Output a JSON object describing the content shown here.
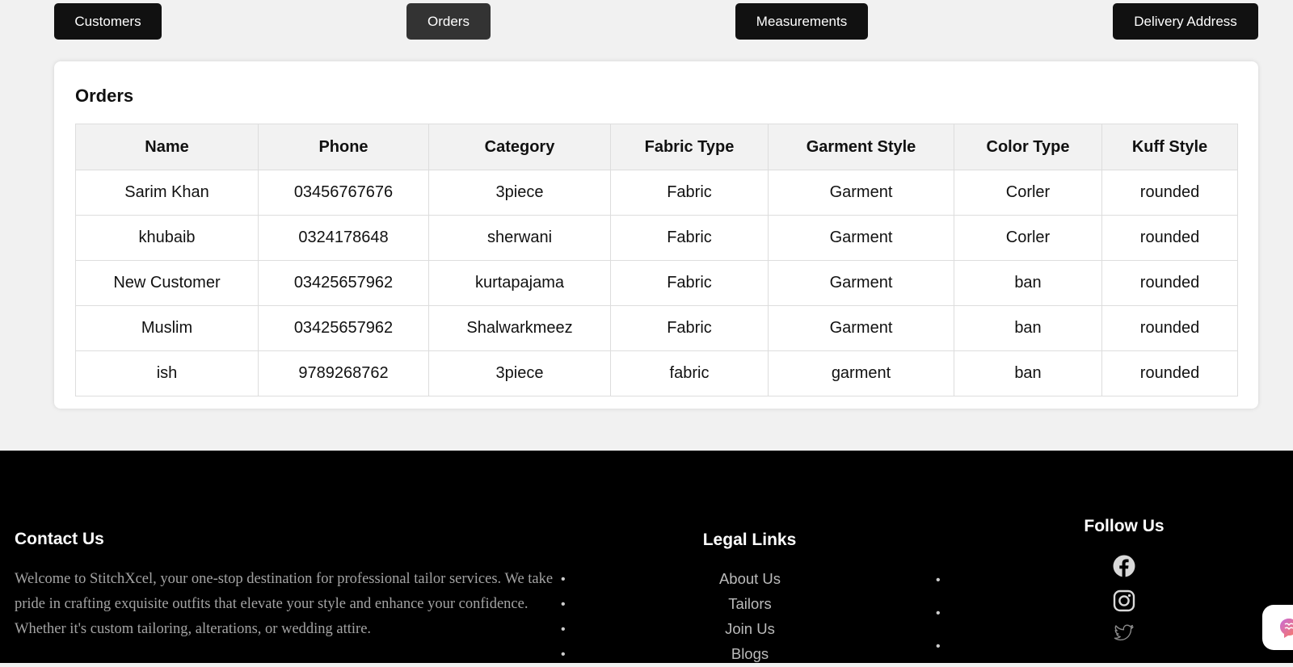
{
  "tabs": [
    {
      "label": "Customers",
      "active": false
    },
    {
      "label": "Orders",
      "active": true
    },
    {
      "label": "Measurements",
      "active": false
    },
    {
      "label": "Delivery Address",
      "active": false
    }
  ],
  "orders": {
    "title": "Orders",
    "columns": [
      "Name",
      "Phone",
      "Category",
      "Fabric Type",
      "Garment Style",
      "Color Type",
      "Kuff Style"
    ],
    "rows": [
      [
        "Sarim Khan",
        "03456767676",
        "3piece",
        "Fabric",
        "Garment",
        "Corler",
        "rounded"
      ],
      [
        "khubaib",
        "0324178648",
        "sherwani",
        "Fabric",
        "Garment",
        "Corler",
        "rounded"
      ],
      [
        "New Customer",
        "03425657962",
        "kurtapajama",
        "Fabric",
        "Garment",
        "ban",
        "rounded"
      ],
      [
        "Muslim",
        "03425657962",
        "Shalwarkmeez",
        "Fabric",
        "Garment",
        "ban",
        "rounded"
      ],
      [
        "ish",
        "9789268762",
        "3piece",
        "fabric",
        "garment",
        "ban",
        "rounded"
      ]
    ]
  },
  "footer": {
    "contact": {
      "title": "Contact Us",
      "text": "Welcome to StitchXcel, your one-stop destination for professional tailor services. We take pride in crafting exquisite outfits that elevate your style and enhance your confidence. Whether it's custom tailoring, alterations, or wedding attire."
    },
    "legal": {
      "title": "Legal Links",
      "links": [
        "About Us",
        "Tailors",
        "Join Us",
        "Blogs"
      ]
    },
    "follow": {
      "title": "Follow Us",
      "icons": [
        "facebook-icon",
        "instagram-icon",
        "twitter-icon"
      ]
    }
  },
  "colors": {
    "tab_bg": "#111111",
    "tab_active_bg": "#333333",
    "page_bg": "#f1f1f1",
    "footer_bg": "#000000",
    "footer_muted_text": "#a3a3a3"
  }
}
